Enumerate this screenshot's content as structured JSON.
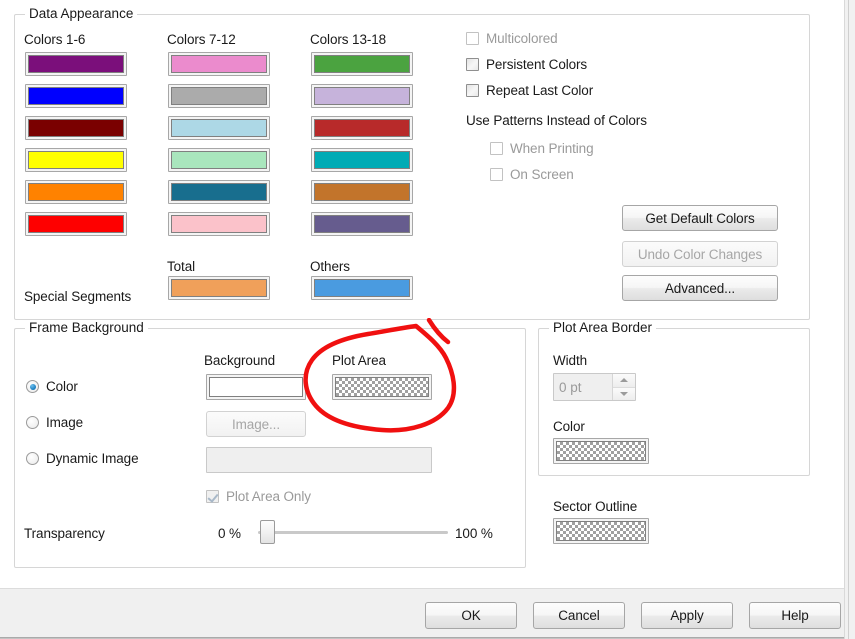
{
  "dialog": {
    "groups": {
      "data_appearance": "Data Appearance",
      "frame_background": "Frame Background",
      "plot_area_border": "Plot Area Border"
    }
  },
  "data_appearance": {
    "column_headers": [
      "Colors 1-6",
      "Colors 7-12",
      "Colors 13-18"
    ],
    "special_segments_label": "Special Segments",
    "special_headers": [
      "Total",
      "Others"
    ],
    "colors_1_6": [
      "#7B0F7B",
      "#0000FE",
      "#7A0000",
      "#FFFF00",
      "#FF8200",
      "#FE0000"
    ],
    "colors_7_12": [
      "#EB8BCD",
      "#ABABAB",
      "#ADD8E6",
      "#A9E6BD",
      "#186E8E",
      "#FBC2CA"
    ],
    "colors_13_18": [
      "#4BA340",
      "#C6B3DB",
      "#B82A2A",
      "#00ABB5",
      "#C2742B",
      "#665C8E"
    ],
    "special_colors": {
      "total": "#F0A05A",
      "others": "#4A9BE0"
    },
    "checkboxes": [
      {
        "label": "Multicolored",
        "checked": false,
        "enabled": false
      },
      {
        "label": "Persistent Colors",
        "checked": false,
        "enabled": true
      },
      {
        "label": "Repeat Last Color",
        "checked": false,
        "enabled": true
      }
    ],
    "patterns_label": "Use Patterns Instead of Colors",
    "pattern_checkboxes": [
      {
        "label": "When Printing",
        "checked": false,
        "enabled": false
      },
      {
        "label": "On Screen",
        "checked": false,
        "enabled": false
      }
    ],
    "buttons": [
      {
        "label": "Get Default Colors",
        "enabled": true
      },
      {
        "label": "Undo Color Changes",
        "enabled": false
      },
      {
        "label": "Advanced...",
        "enabled": true
      }
    ]
  },
  "frame_background": {
    "radios": [
      {
        "label": "Color",
        "selected": true
      },
      {
        "label": "Image",
        "selected": false
      },
      {
        "label": "Dynamic Image",
        "selected": false
      }
    ],
    "background_label": "Background",
    "plot_area_label": "Plot Area",
    "background_swatch_color": "#FFFFFF",
    "plot_area_swatch": "checkered",
    "image_button": {
      "label": "Image...",
      "enabled": false
    },
    "image_path_value": "",
    "plot_area_only": {
      "label": "Plot Area Only",
      "checked": true,
      "enabled": false
    },
    "transparency_label": "Transparency",
    "transparency_min": "0 %",
    "transparency_max": "100 %",
    "transparency_value": 0
  },
  "plot_area_border": {
    "width_label": "Width",
    "width_value": "0 pt",
    "color_label": "Color",
    "color_swatch": "checkered",
    "sector_outline_label": "Sector Outline",
    "sector_outline_swatch": "checkered"
  },
  "footer": {
    "buttons": [
      {
        "label": "OK",
        "enabled": true
      },
      {
        "label": "Cancel",
        "enabled": true
      },
      {
        "label": "Apply",
        "enabled": true
      },
      {
        "label": "Help",
        "enabled": true
      }
    ]
  },
  "annotation": {
    "shape": "red-circle-around-plot-area-swatch",
    "color": "#F01010"
  }
}
